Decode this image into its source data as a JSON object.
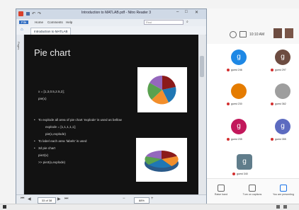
{
  "reader": {
    "window_title": "Introduction to MATLAB.pdf - Nitro Reader 3",
    "menu": [
      "File",
      "Home",
      "Comments",
      "Help"
    ],
    "search_placeholder": "Find",
    "tab_title": "Introduction to MATLAB",
    "side_label": "Pages",
    "page_field": "33 of 38",
    "zoom_field": "88%"
  },
  "slide": {
    "title": "Pie chart",
    "lines": [
      "x = [1,3,0.5,2.5,2];",
      "pie(x)",
      "To explode all area of pie chart 'explode' is used as bellow",
      "explode = [1,1,1,1,1];",
      "pie(x,explode)",
      "To label each area 'labels' is used",
      "3d pie chart",
      "pie3(x)",
      ">> pie3(x,explode)"
    ],
    "pie_colors": [
      "#1f77b4",
      "#8b1a1a",
      "#f28e2b",
      "#59a14f",
      "#9467bd"
    ]
  },
  "meeting": {
    "clock": "10:10 AM",
    "participants": [
      {
        "initial": "g",
        "name": "guest 246",
        "color": "#1e88e5"
      },
      {
        "initial": "g",
        "name": "guest 297",
        "color": "#6d4c41"
      },
      {
        "initial": "",
        "name": "guest 230",
        "color": "#e57c00"
      },
      {
        "initial": "",
        "name": "guest 362",
        "color": "#9e9e9e"
      },
      {
        "initial": "g",
        "name": "guest 235",
        "color": "#c2185b"
      },
      {
        "initial": "g",
        "name": "guest 355",
        "color": "#5c6bc0"
      },
      {
        "initial": "g",
        "name": "guest 340",
        "color": "#607d8b"
      }
    ],
    "controls": [
      "Raise hand",
      "Turn on captions",
      "You are presenting"
    ]
  }
}
